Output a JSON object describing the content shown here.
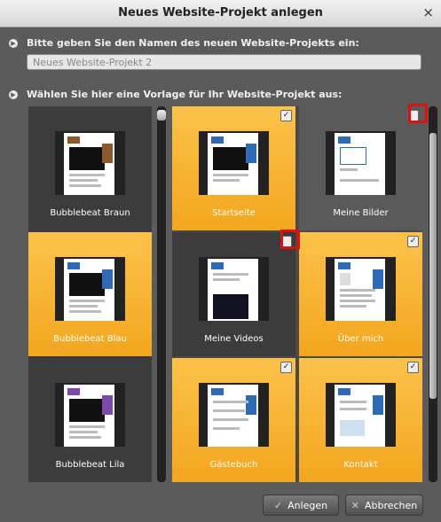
{
  "dialog": {
    "title": "Neues Website-Projekt anlegen",
    "close_glyph": "×"
  },
  "step1": {
    "label": "Bitte geben Sie den Namen des neuen Website-Projekts ein:",
    "value": "Neues Website-Projekt 2"
  },
  "step2": {
    "label": "Wählen Sie hier eine Vorlage für Ihr Website-Projekt aus:"
  },
  "designs": [
    {
      "label": "Bubblebeat Braun",
      "selected": false,
      "accent": "#8b5a2b"
    },
    {
      "label": "Bubblebeat Blau",
      "selected": true,
      "accent": "#2f6bb5"
    },
    {
      "label": "Bubblebeat Lila",
      "selected": false,
      "accent": "#7b4aa8"
    }
  ],
  "pages": [
    {
      "label": "Startseite",
      "checked": true
    },
    {
      "label": "Meine Bilder",
      "checked": false
    },
    {
      "label": "Meine Videos",
      "checked": false
    },
    {
      "label": "Über mich",
      "checked": true
    },
    {
      "label": "Gästebuch",
      "checked": true
    },
    {
      "label": "Kontakt",
      "checked": true
    }
  ],
  "buttons": {
    "create": "Anlegen",
    "cancel": "Abbrechen"
  },
  "colors": {
    "selected_tile": "#f7b234",
    "highlight_box": "#e01010"
  }
}
